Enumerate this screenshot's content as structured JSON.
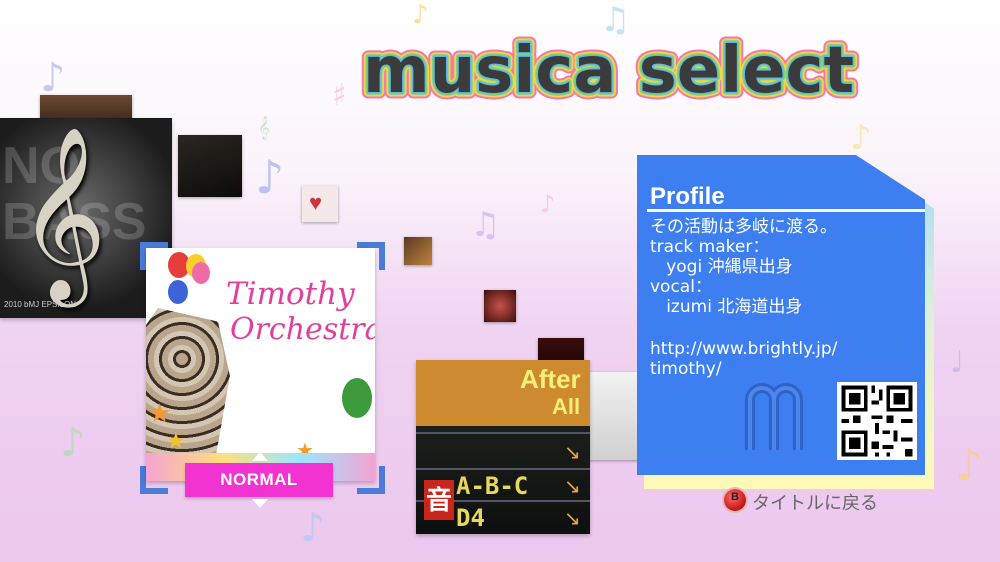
{
  "screen": {
    "title": "musica select"
  },
  "albums": {
    "left": {
      "caption": "2010 bMJ EPSILON"
    },
    "selected": {
      "art_text_line1": "Timothy",
      "art_text_line2": "Orchestra"
    },
    "right": {
      "art_text_line1": "After",
      "art_text_line2": "All",
      "board_text_1": "A-B-C",
      "board_text_2": "D4",
      "board_kanji": "音"
    }
  },
  "difficulty": {
    "label": "NORMAL"
  },
  "profile": {
    "heading": "Profile",
    "lines": [
      "その活動は多岐に渡る。",
      "track maker：",
      "   yogi 沖縄県出身",
      "vocal：",
      "   izumi 北海道出身",
      "",
      "http://www.brightly.jp/",
      "timothy/"
    ]
  },
  "footer": {
    "back_button_glyph": "B",
    "back_label": "タイトルに戻る"
  },
  "colors": {
    "profile_bg": "#3d7ff0",
    "badge": "#f233d2",
    "bracket": "#4a7bd8"
  }
}
